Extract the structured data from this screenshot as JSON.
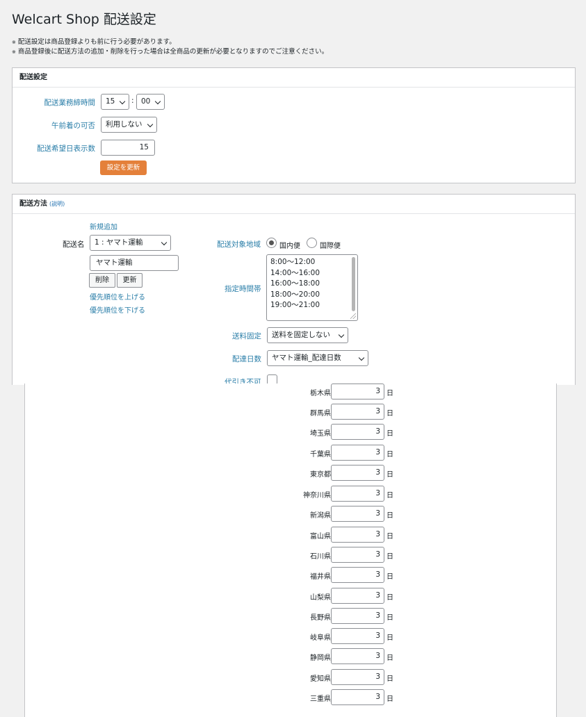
{
  "page": {
    "title": "Welcart Shop 配送設定",
    "notices": [
      "配送設定は商品登録よりも前に行う必要があります。",
      "商品登録後に配送方法の追加・削除を行った場合は全商品の更新が必要となりますのでご注意ください。"
    ],
    "notice_mark": "※"
  },
  "settings": {
    "heading": "配送設定",
    "cutoff_label": "配送業務締時間",
    "cutoff_hour": "15",
    "cutoff_sep": ":",
    "cutoff_minute": "00",
    "morning_label": "午前着の可否",
    "morning_value": "利用しない",
    "days_label": "配送希望日表示数",
    "days_value": "15",
    "update_button": "設定を更新"
  },
  "methods": {
    "heading": "配送方法",
    "help_link": "(説明)",
    "add_new": "新規追加",
    "name_label": "配送名",
    "name_select": "1 : ヤマト運輸",
    "name_input": "ヤマト運輸",
    "delete_button": "削除",
    "update_button": "更新",
    "priority_up": "優先順位を上げる",
    "priority_down": "優先順位を下げる",
    "region_label": "配送対象地域",
    "region_domestic": "国内便",
    "region_international": "国際便",
    "time_label": "指定時間帯",
    "time_slots": [
      "8:00〜12:00",
      "14:00〜16:00",
      "16:00〜18:00",
      "18:00〜20:00",
      "19:00〜21:00"
    ],
    "fixed_fee_label": "送料固定",
    "fixed_fee_value": "送料を固定しない",
    "delivery_days_label": "配達日数",
    "delivery_days_value": "ヤマト運輸_配達日数",
    "no_cod_label": "代引き不可"
  },
  "prefectures": {
    "unit": "日",
    "rows": [
      {
        "name": "栃木県",
        "days": "3"
      },
      {
        "name": "群馬県",
        "days": "3"
      },
      {
        "name": "埼玉県",
        "days": "3"
      },
      {
        "name": "千葉県",
        "days": "3"
      },
      {
        "name": "東京都",
        "days": "3"
      },
      {
        "name": "神奈川県",
        "days": "3"
      },
      {
        "name": "新潟県",
        "days": "3"
      },
      {
        "name": "富山県",
        "days": "3"
      },
      {
        "name": "石川県",
        "days": "3"
      },
      {
        "name": "福井県",
        "days": "3"
      },
      {
        "name": "山梨県",
        "days": "3"
      },
      {
        "name": "長野県",
        "days": "3"
      },
      {
        "name": "岐阜県",
        "days": "3"
      },
      {
        "name": "静岡県",
        "days": "3"
      },
      {
        "name": "愛知県",
        "days": "3"
      },
      {
        "name": "三重県",
        "days": "3"
      }
    ]
  }
}
